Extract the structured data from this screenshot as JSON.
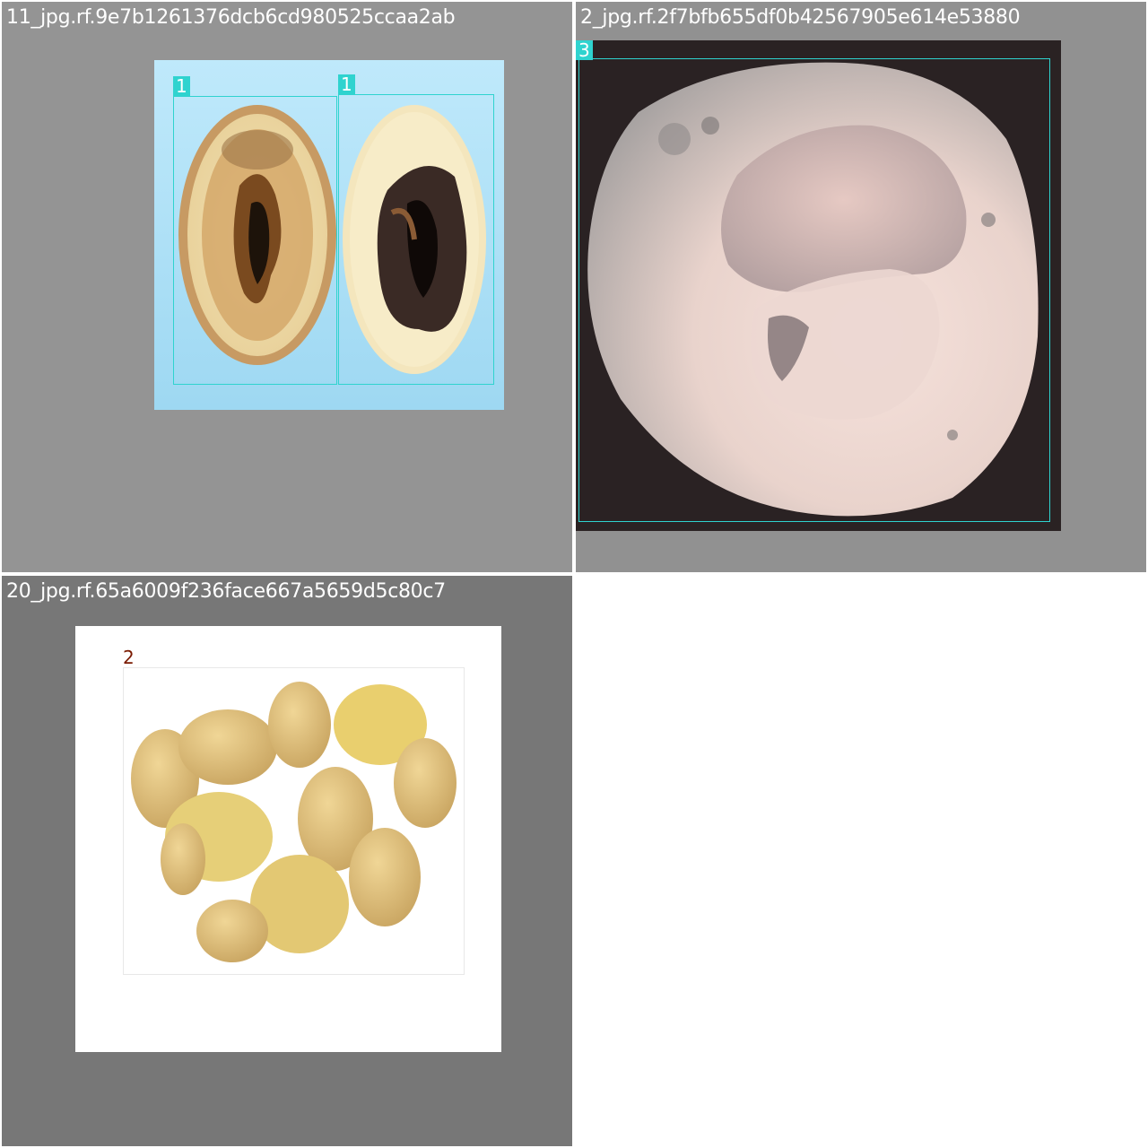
{
  "panels": [
    {
      "title": "11_jpg.rf.9e7b1261376dcb6cd980525ccaa2ab",
      "background": "#949494",
      "subject": "halved-potatoes-hollow-heart",
      "boxes": [
        {
          "label": "1",
          "color": "#2fd3cf"
        },
        {
          "label": "1",
          "color": "#2fd3cf"
        }
      ]
    },
    {
      "title": "2_jpg.rf.2f7bfb655df0b42567905e614e53880",
      "background": "#919191",
      "subject": "single-potato-with-lesion",
      "boxes": [
        {
          "label": "3",
          "color": "#2fd3cf"
        }
      ]
    },
    {
      "title": "20_jpg.rf.65a6009f236face667a5659d5c80c7",
      "background": "#777777",
      "subject": "pile-of-healthy-potatoes",
      "boxes": [
        {
          "label": "2",
          "color": "#e8e8e8",
          "label_text_color": "#7a1a00"
        }
      ]
    }
  ]
}
